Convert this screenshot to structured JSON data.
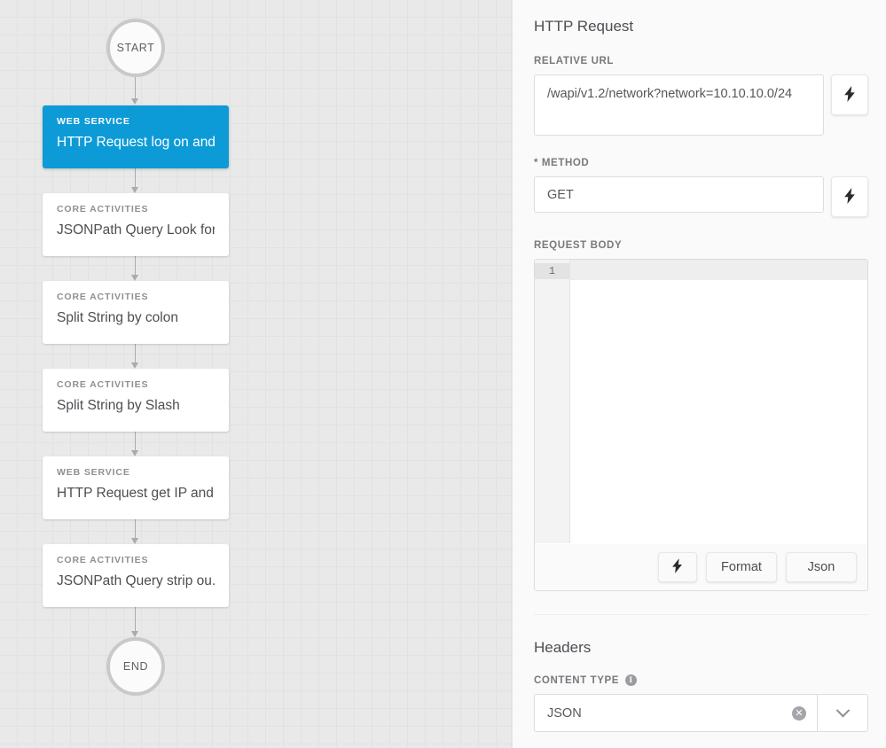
{
  "canvas": {
    "start_label": "START",
    "end_label": "END",
    "nodes": [
      {
        "category": "WEB SERVICE",
        "title": "HTTP Request log on and ...",
        "selected": true
      },
      {
        "category": "CORE ACTIVITIES",
        "title": "JSONPath Query Look for...",
        "selected": false
      },
      {
        "category": "CORE ACTIVITIES",
        "title": "Split String by colon",
        "selected": false
      },
      {
        "category": "CORE ACTIVITIES",
        "title": "Split String by Slash",
        "selected": false
      },
      {
        "category": "WEB SERVICE",
        "title": "HTTP Request get IP and ...",
        "selected": false
      },
      {
        "category": "CORE ACTIVITIES",
        "title": "JSONPath Query strip ou...",
        "selected": false
      }
    ]
  },
  "panel": {
    "title": "HTTP Request",
    "url": {
      "label": "RELATIVE URL",
      "value": "/wapi/v1.2/network?network=10.10.10.0/24",
      "bolt_icon": "lightning-bolt-icon"
    },
    "method": {
      "label": "* METHOD",
      "value": "GET",
      "bolt_icon": "lightning-bolt-icon"
    },
    "request_body": {
      "label": "REQUEST BODY",
      "value": "",
      "line_numbers": [
        "1"
      ],
      "buttons": {
        "bolt": "⚡",
        "format": "Format",
        "json": "Json"
      }
    },
    "headers": {
      "title": "Headers",
      "content_type": {
        "label": "CONTENT TYPE",
        "info_icon": "info-icon",
        "value": "JSON",
        "clear_icon": "clear-icon",
        "caret_icon": "chevron-down-icon"
      }
    }
  },
  "colors": {
    "accent": "#0d9bd7",
    "canvas_bg": "#e9e9e9",
    "grid_line": "#e2e2e2",
    "panel_bg": "#fafafa",
    "text": "#4c4e52",
    "muted_text": "#8e9094",
    "border": "#dcdddf"
  }
}
